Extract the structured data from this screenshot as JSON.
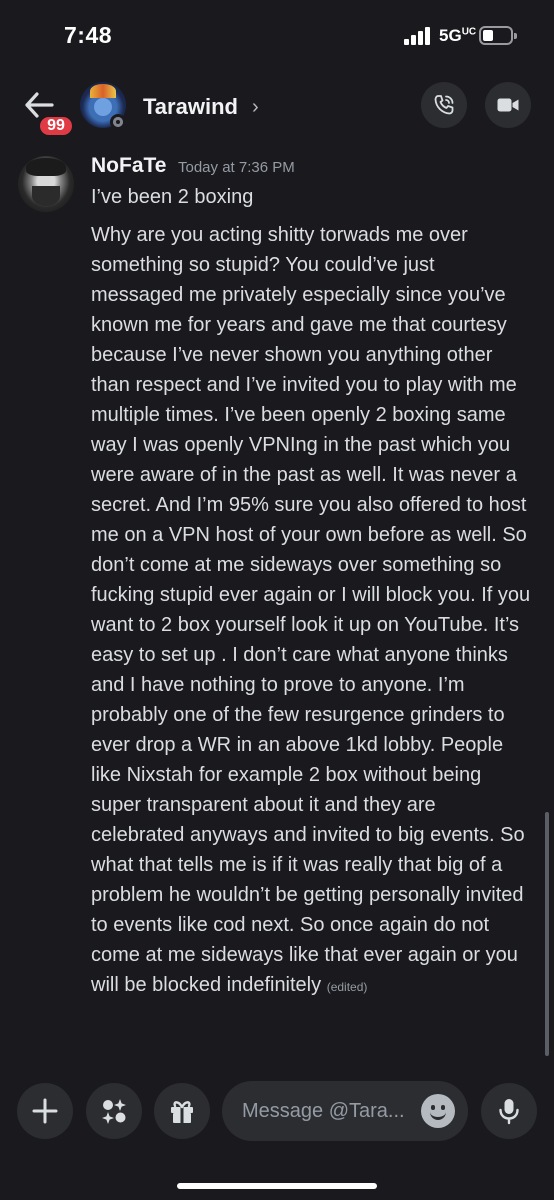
{
  "status_bar": {
    "time": "7:48",
    "network": "5G",
    "network_sup": "UC"
  },
  "header": {
    "unread_badge": "99",
    "channel_name": "Tarawind",
    "chevron": "›"
  },
  "message": {
    "author": "NoFaTe",
    "timestamp": "Today at 7:36 PM",
    "line1": "I’ve been 2 boxing",
    "body": "Why are you acting shitty torwads me over something so stupid? You could’ve just messaged me privately especially since you’ve known me for years and gave me that courtesy because I’ve never shown you anything other than respect and I’ve invited you to play with me multiple times. I’ve been openly 2 boxing same way I was openly VPNIng in the past which you were aware of in the past as well. It was never a secret. And I’m 95% sure you also offered to host me on a VPN host of your own before as well. So don’t come at me sideways over something so fucking stupid ever again or I will block you. If you want to 2 box yourself look it up on YouTube. It’s easy to set up . I don’t care what anyone thinks and I have nothing to prove to anyone. I’m probably one of the few resurgence grinders to ever drop a WR in an above 1kd lobby. People like Nixstah for example 2 box without being super transparent about it and they are celebrated anyways and invited to big events. So what that tells me is if it was really that big of a problem he wouldn’t be getting personally invited to events like cod next. So once again do not come at me sideways like that ever again or you will be blocked indefinitely",
    "edited": "(edited)"
  },
  "composer": {
    "placeholder": "Message @Tara..."
  },
  "icons": {
    "back": "arrow-left-icon",
    "call": "phone-call-icon",
    "video": "video-camera-icon",
    "plus": "plus-icon",
    "apps": "apps-icon",
    "gift": "gift-icon",
    "emoji": "emoji-icon",
    "mic": "microphone-icon"
  },
  "colors": {
    "background": "#1a1a1e",
    "badge": "#e03b45",
    "button": "#2b2d31",
    "text_muted": "#949ba4"
  }
}
